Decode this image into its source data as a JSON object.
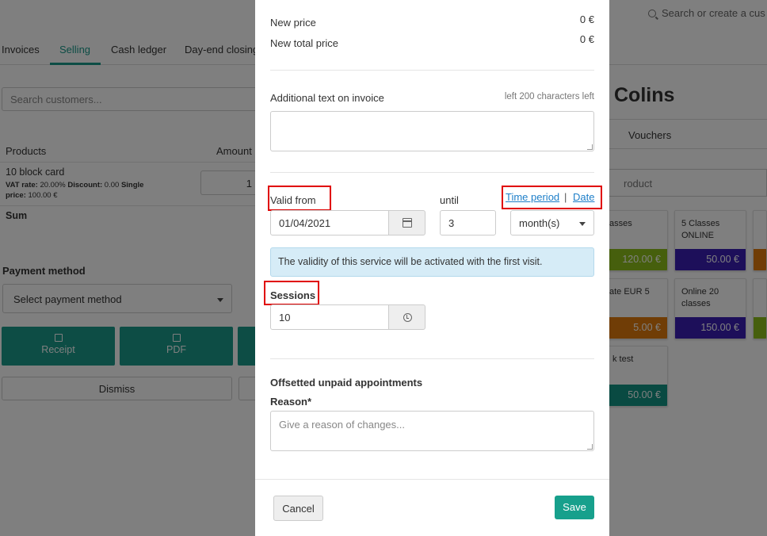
{
  "background": {
    "search_placeholder": "Search or create a cus",
    "tabs": [
      {
        "label": "Invoices"
      },
      {
        "label": "Selling"
      },
      {
        "label": "Cash ledger"
      },
      {
        "label": "Day-end closing"
      }
    ],
    "customer_search_placeholder": "Search customers...",
    "products_header": "Products",
    "amount_header": "Amount",
    "product": {
      "name": "10 block card",
      "meta_vat_label": "VAT rate:",
      "meta_vat": "20.00%",
      "meta_discount_label": "Discount:",
      "meta_discount": "0.00",
      "meta_single": "Single",
      "meta_price_label": "price:",
      "meta_price": "100.00 €",
      "amount": "1"
    },
    "sum_label": "Sum",
    "payment_method_label": "Payment method",
    "payment_method_placeholder": "Select payment method",
    "receipt_label": "Receipt",
    "pdf_label": "PDF",
    "dismiss_label": "Dismiss",
    "customer_name": "Colins",
    "vouchers_tab": "Vouchers",
    "product_search_placeholder": "roduct",
    "cards": [
      {
        "name": "asses",
        "price": "120.00 €",
        "color": "#8cbf1a"
      },
      {
        "name": "5 Classes ONLINE",
        "price": "50.00 €",
        "color": "#3a1fb5"
      },
      {
        "name": "ate EUR 5",
        "price": "5.00 €",
        "color": "#e07b0c"
      },
      {
        "name": "Online 20 classes",
        "price": "150.00 €",
        "color": "#3a1fb5"
      },
      {
        "name": "k test",
        "price": "50.00 €",
        "color": "#129484"
      }
    ]
  },
  "modal": {
    "new_price_label": "New price",
    "new_price_value": "0 €",
    "new_total_price_label": "New total price",
    "new_total_price_value": "0 €",
    "additional_text_label": "Additional text on invoice",
    "chars_left_hint": "left 200 characters left",
    "additional_text_value": "",
    "valid_from_label": "Valid from",
    "valid_from_value": "01/04/2021",
    "until_label": "until",
    "until_value": "3",
    "until_unit": "month(s)",
    "time_period_link": "Time period",
    "separator": "|",
    "date_link": "Date",
    "info_text": "The validity of this service will be activated with the first visit.",
    "sessions_label": "Sessions",
    "sessions_value": "10",
    "offset_label": "Offsetted unpaid appointments",
    "reason_label": "Reason*",
    "reason_placeholder": "Give a reason of changes...",
    "cancel_label": "Cancel",
    "save_label": "Save",
    "accent_color": "#17a08c",
    "highlight_color": "#e00000"
  }
}
